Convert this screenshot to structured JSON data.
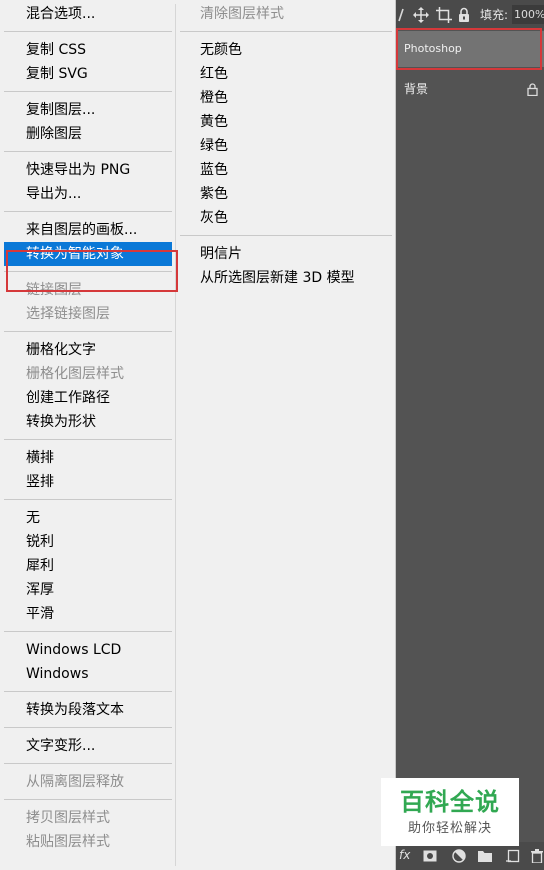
{
  "menu": {
    "left_items": [
      {
        "label": "混合选项...",
        "disabled": false
      },
      {
        "separator": true
      },
      {
        "label": "复制 CSS",
        "disabled": false
      },
      {
        "label": "复制 SVG",
        "disabled": false
      },
      {
        "separator": true
      },
      {
        "label": "复制图层...",
        "disabled": false
      },
      {
        "label": "删除图层",
        "disabled": false
      },
      {
        "separator": true
      },
      {
        "label": "快速导出为 PNG",
        "disabled": false
      },
      {
        "label": "导出为...",
        "disabled": false
      },
      {
        "separator": true
      },
      {
        "label": "来自图层的画板...",
        "disabled": false
      },
      {
        "label": "转换为智能对象",
        "disabled": false,
        "highlighted": true
      },
      {
        "separator": true
      },
      {
        "label": "链接图层",
        "disabled": true
      },
      {
        "label": "选择链接图层",
        "disabled": true
      },
      {
        "separator": true
      },
      {
        "label": "栅格化文字",
        "disabled": false
      },
      {
        "label": "栅格化图层样式",
        "disabled": true
      },
      {
        "label": "创建工作路径",
        "disabled": false
      },
      {
        "label": "转换为形状",
        "disabled": false
      },
      {
        "separator": true
      },
      {
        "label": "横排",
        "disabled": false
      },
      {
        "label": "竖排",
        "disabled": false
      },
      {
        "separator": true
      },
      {
        "label": "无",
        "disabled": false
      },
      {
        "label": "锐利",
        "disabled": false
      },
      {
        "label": "犀利",
        "disabled": false
      },
      {
        "label": "浑厚",
        "disabled": false
      },
      {
        "label": "平滑",
        "disabled": false
      },
      {
        "separator": true
      },
      {
        "label": "Windows LCD",
        "disabled": false
      },
      {
        "label": "Windows",
        "disabled": false
      },
      {
        "separator": true
      },
      {
        "label": "转换为段落文本",
        "disabled": false
      },
      {
        "separator": true
      },
      {
        "label": "文字变形...",
        "disabled": false
      },
      {
        "separator": true
      },
      {
        "label": "从隔离图层释放",
        "disabled": true
      },
      {
        "separator": true
      },
      {
        "label": "拷贝图层样式",
        "disabled": true
      },
      {
        "label": "粘贴图层样式",
        "disabled": true
      }
    ],
    "right_items": [
      {
        "label": "清除图层样式",
        "disabled": true
      },
      {
        "separator": true
      },
      {
        "label": "无颜色",
        "disabled": false
      },
      {
        "label": "红色",
        "disabled": false
      },
      {
        "label": "橙色",
        "disabled": false
      },
      {
        "label": "黄色",
        "disabled": false
      },
      {
        "label": "绿色",
        "disabled": false
      },
      {
        "label": "蓝色",
        "disabled": false
      },
      {
        "label": "紫色",
        "disabled": false
      },
      {
        "label": "灰色",
        "disabled": false
      },
      {
        "separator": true
      },
      {
        "label": "明信片",
        "disabled": false
      },
      {
        "label": "从所选图层新建 3D 模型",
        "disabled": false
      }
    ]
  },
  "layers_panel": {
    "toolbar": {
      "icons": [
        "brush-lock-icon",
        "move-lock-icon",
        "artboard-lock-icon",
        "lock-icon"
      ],
      "fill_label": "填充:",
      "fill_value": "100%"
    },
    "layers": [
      {
        "name": "Photoshop",
        "selected": true
      },
      {
        "name": "背景",
        "selected": false,
        "locked": true
      }
    ],
    "bottom_icons": [
      "fx-icon",
      "mask-icon",
      "adjustment-icon",
      "folder-icon",
      "new-layer-icon",
      "trash-icon"
    ]
  },
  "watermark": {
    "title": "百科全说",
    "subtitle": "助你轻松解决"
  },
  "colors": {
    "menu_bg": "#f0f0f0",
    "highlight": "#0a78d7",
    "disabled_text": "#8e8e8e",
    "panel_bg": "#535353",
    "selected_layer": "#737373",
    "annotation_red": "#d5383a",
    "watermark_green": "#31a852"
  }
}
